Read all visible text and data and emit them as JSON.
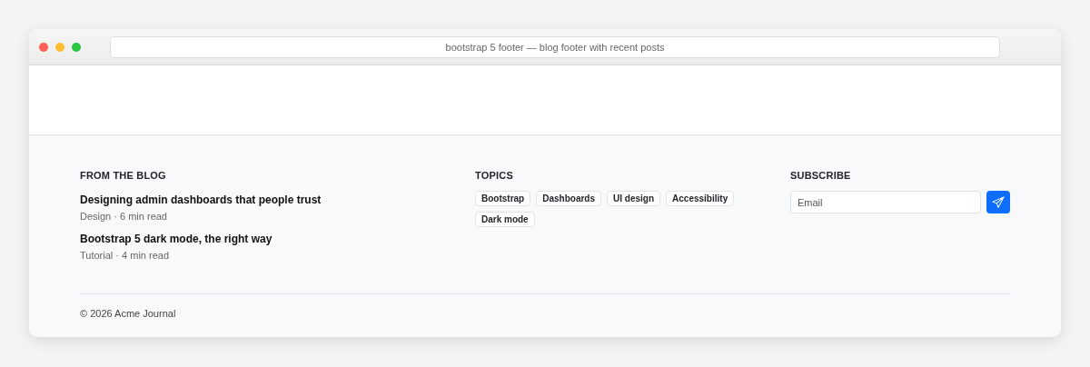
{
  "window": {
    "title": "bootstrap 5 footer — blog footer with recent posts"
  },
  "blog": {
    "heading": "FROM THE BLOG",
    "posts": [
      {
        "title": "Designing admin dashboards that people trust",
        "meta": "Design · 6 min read"
      },
      {
        "title": "Bootstrap 5 dark mode, the right way",
        "meta": "Tutorial · 4 min read"
      }
    ]
  },
  "topics": {
    "heading": "TOPICS",
    "tags": [
      "Bootstrap",
      "Dashboards",
      "UI design",
      "Accessibility",
      "Dark mode"
    ]
  },
  "subscribe": {
    "heading": "SUBSCRIBE",
    "placeholder": "Email"
  },
  "copyright": "© 2026 Acme Journal"
}
